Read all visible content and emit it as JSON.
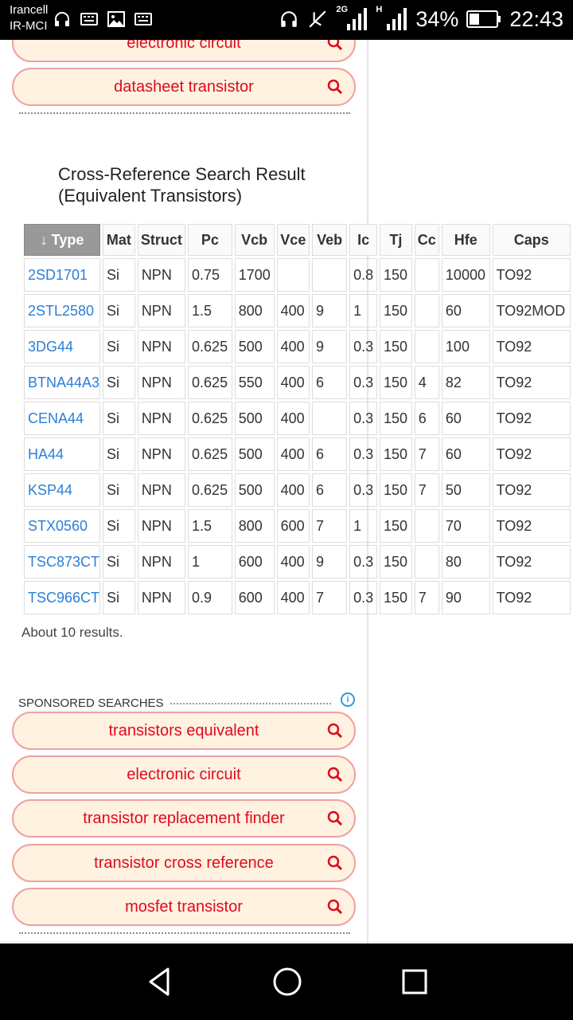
{
  "status_bar": {
    "carrier_line1": "Irancell",
    "carrier_line2": "IR-MCI",
    "battery": "34%",
    "time": "22:43",
    "network_small": "2G",
    "network_h": "H"
  },
  "top_searches": [
    {
      "label": "electronic circuit"
    },
    {
      "label": "datasheet transistor"
    }
  ],
  "result": {
    "title_line1": "Cross-Reference Search Result",
    "title_line2": "(Equivalent Transistors)",
    "columns": [
      "↓ Type",
      "Mat",
      "Struct",
      "Pc",
      "Vcb",
      "Vce",
      "Veb",
      "Ic",
      "Tj",
      "Cc",
      "Hfe",
      "Caps"
    ],
    "rows": [
      [
        "2SD1701",
        "Si",
        "NPN",
        "0.75",
        "1700",
        "",
        "",
        "0.8",
        "150",
        "",
        "10000",
        "TO92"
      ],
      [
        "2STL2580",
        "Si",
        "NPN",
        "1.5",
        "800",
        "400",
        "9",
        "1",
        "150",
        "",
        "60",
        "TO92MOD"
      ],
      [
        "3DG44",
        "Si",
        "NPN",
        "0.625",
        "500",
        "400",
        "9",
        "0.3",
        "150",
        "",
        "100",
        "TO92"
      ],
      [
        "BTNA44A3",
        "Si",
        "NPN",
        "0.625",
        "550",
        "400",
        "6",
        "0.3",
        "150",
        "4",
        "82",
        "TO92"
      ],
      [
        "CENA44",
        "Si",
        "NPN",
        "0.625",
        "500",
        "400",
        "",
        "0.3",
        "150",
        "6",
        "60",
        "TO92"
      ],
      [
        "HA44",
        "Si",
        "NPN",
        "0.625",
        "500",
        "400",
        "6",
        "0.3",
        "150",
        "7",
        "60",
        "TO92"
      ],
      [
        "KSP44",
        "Si",
        "NPN",
        "0.625",
        "500",
        "400",
        "6",
        "0.3",
        "150",
        "7",
        "50",
        "TO92"
      ],
      [
        "STX0560",
        "Si",
        "NPN",
        "1.5",
        "800",
        "600",
        "7",
        "1",
        "150",
        "",
        "70",
        "TO92"
      ],
      [
        "TSC873CT",
        "Si",
        "NPN",
        "1",
        "600",
        "400",
        "9",
        "0.3",
        "150",
        "",
        "80",
        "TO92"
      ],
      [
        "TSC966CT",
        "Si",
        "NPN",
        "0.9",
        "600",
        "400",
        "7",
        "0.3",
        "150",
        "7",
        "90",
        "TO92"
      ]
    ],
    "count_text": "About 10 results."
  },
  "sponsored": {
    "heading": "SPONSORED SEARCHES",
    "info_icon": "i",
    "items": [
      {
        "label": "transistors equivalent"
      },
      {
        "label": "electronic circuit"
      },
      {
        "label": "transistor replacement finder"
      },
      {
        "label": "transistor cross reference"
      },
      {
        "label": "mosfet transistor"
      }
    ]
  },
  "colors": {
    "accent_red": "#e00a1e",
    "pill_bg": "#fff2e0",
    "link_blue": "#2a7fd6"
  },
  "icons": {
    "search": "magnifier-icon",
    "back": "back-triangle-icon",
    "home": "home-circle-icon",
    "recents": "recents-square-icon"
  }
}
